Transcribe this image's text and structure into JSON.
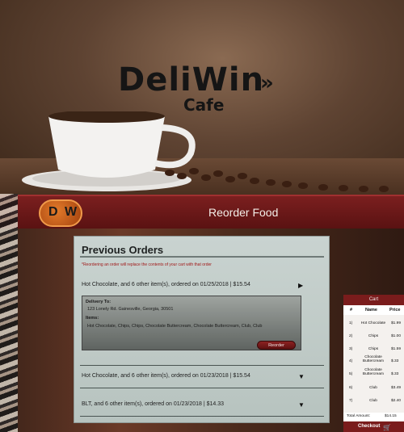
{
  "hero": {
    "brand_name": "DeliWin",
    "brand_chevrons": "»",
    "brand_sub": "Cafe"
  },
  "header": {
    "badge_left": "D",
    "badge_right": "W",
    "title": "Reorder Food"
  },
  "orders": {
    "title": "Previous Orders",
    "note": "*Reordering an order will replace the contents of your cart with that order",
    "list": [
      {
        "summary": "Hot Chocolate, and 6 other item(s), ordered on 01/25/2018 | $15.54",
        "arrow": "▶"
      },
      {
        "summary": "Hot Chocolate, and 6 other item(s), ordered on 01/23/2018 | $15.54",
        "arrow": "▼"
      },
      {
        "summary": "BLT, and 6 other item(s), ordered on 01/23/2018 | $14.33",
        "arrow": "▼"
      }
    ],
    "detail": {
      "delivery_label": "Delivery To:",
      "delivery_value": "123 Lonely Rd. Gainesville, Georgia, 30501",
      "items_label": "Items:",
      "items_value": "Hot Chocolate, Chips, Chips, Chocolate Buttercream, Chocolate Buttercream, Club, Club",
      "reorder_label": "Reorder"
    }
  },
  "cart": {
    "title": "Cart",
    "col_num": "#",
    "col_name": "Name",
    "col_price": "Price",
    "items": [
      {
        "num": "1)",
        "name": "Hot Chocolate",
        "price": "$1.99"
      },
      {
        "num": "2)",
        "name": "Chips",
        "price": "$1.00"
      },
      {
        "num": "3)",
        "name": "Chips",
        "price": "$1.59"
      },
      {
        "num": "4)",
        "name": "Chocolate Buttercream",
        "price": "$.33"
      },
      {
        "num": "5)",
        "name": "Chocolate Buttercream",
        "price": "$.33"
      },
      {
        "num": "6)",
        "name": "Club",
        "price": "$3.49"
      },
      {
        "num": "7)",
        "name": "Club",
        "price": "$2.40"
      }
    ],
    "total_label": "Total Amount:",
    "total_value": "$14.15",
    "checkout_label": "Checkout",
    "checkout_icon": "cart-icon"
  }
}
